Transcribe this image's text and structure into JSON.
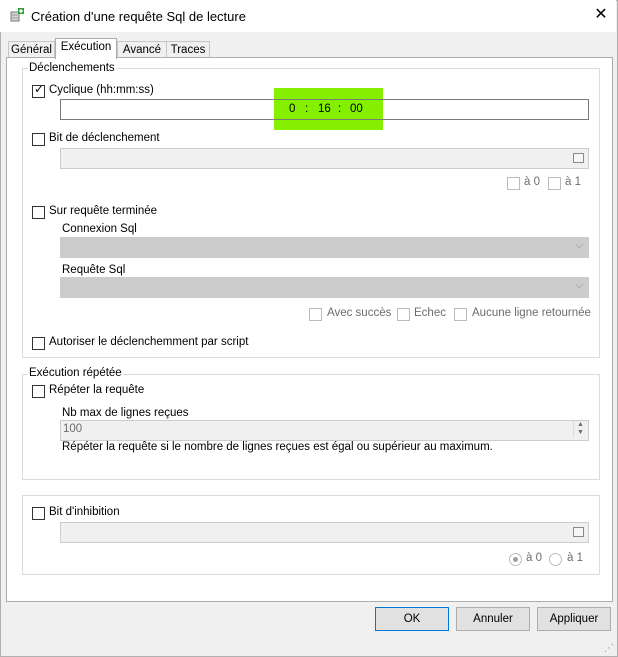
{
  "window": {
    "title": "Création d'une requête Sql de lecture",
    "close_symbol": "✕"
  },
  "tabs": [
    {
      "label": "Général"
    },
    {
      "label": "Exécution"
    },
    {
      "label": "Avancé"
    },
    {
      "label": "Traces"
    }
  ],
  "declenchements": {
    "title": "Déclenchements",
    "cyclique": {
      "label": "Cyclique (hh:mm:ss)",
      "checked": true,
      "hours": "0",
      "minutes": "16",
      "seconds": "00",
      "separator": ":"
    },
    "bit_declenchement": {
      "label": "Bit de déclenchement",
      "checked": false,
      "value": "",
      "a0_label": "à 0",
      "a1_label": "à 1"
    },
    "sur_requete": {
      "label": "Sur requête terminée",
      "checked": false,
      "connexion_label": "Connexion Sql",
      "connexion_value": "",
      "requete_label": "Requête Sql",
      "requete_value": "",
      "avec_succes_label": "Avec succès",
      "echec_label": "Echec",
      "aucune_ligne_label": "Aucune ligne retournée"
    },
    "script": {
      "label": "Autoriser le déclenchemment par script",
      "checked": false
    }
  },
  "execution_repetee": {
    "title": "Exécution répétée",
    "repeter": {
      "label": "Répéter la requête",
      "checked": false
    },
    "nb_max_label": "Nb max de lignes reçues",
    "nb_max_value": "100",
    "info": "Répéter la requête si le nombre de lignes reçues est égal ou supérieur au maximum."
  },
  "inhibition": {
    "label": "Bit d'inhibition",
    "checked": false,
    "value": "",
    "a0_label": "à 0",
    "a1_label": "à 1",
    "selected": "a0"
  },
  "buttons": {
    "ok": "OK",
    "annuler": "Annuler",
    "appliquer": "Appliquer"
  },
  "colors": {
    "highlight": "#84f000",
    "panel": "#ffffff",
    "chrome": "#f0f0f0"
  }
}
